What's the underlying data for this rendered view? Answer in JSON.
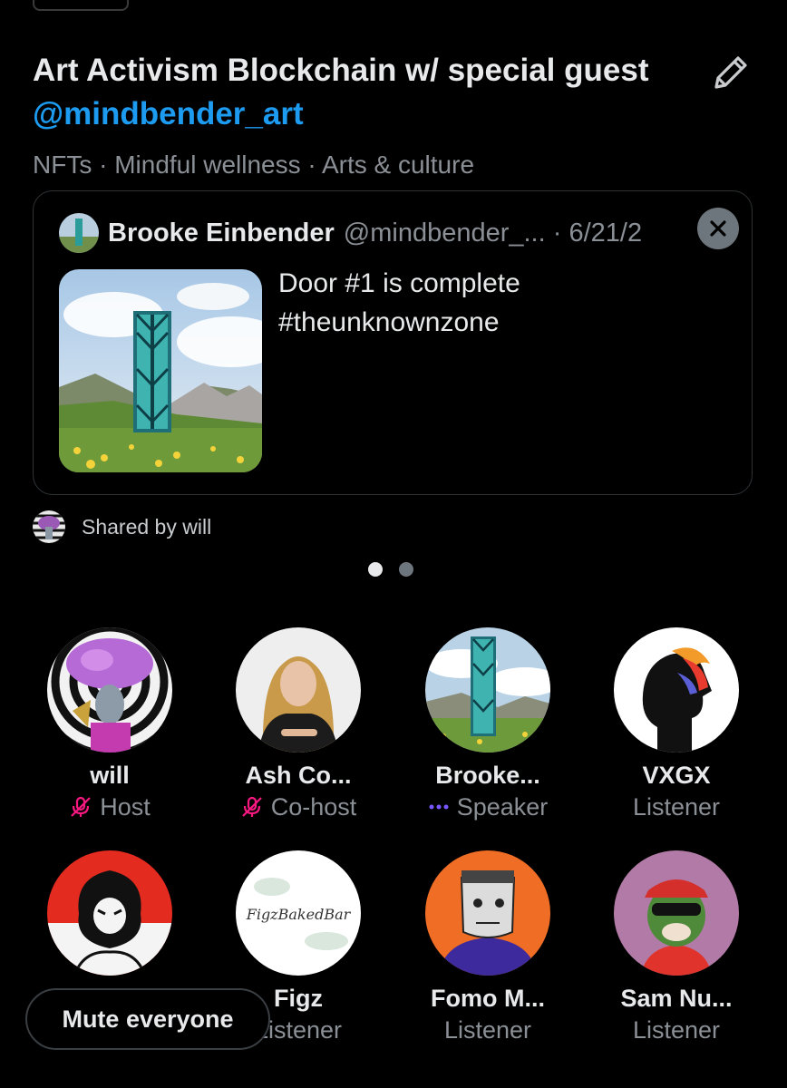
{
  "space": {
    "title_prefix": "Art Activism Blockchain w/ special guest ",
    "title_mention": "@mindbender_art",
    "topics": "NFTs · Mindful wellness · Arts & culture"
  },
  "pinned_tweet": {
    "author": "Brooke Einbender",
    "handle_date": "@mindbender_... · 6/21/2",
    "text_line1": "Door #1 is complete",
    "text_line2": "#theunknownzone"
  },
  "shared_by": "Shared by will",
  "pager": {
    "pages": 2,
    "current": 1
  },
  "participants_row1": [
    {
      "name": "will",
      "role": "Host",
      "role_icon": "muted-mic-icon"
    },
    {
      "name": "Ash Co...",
      "role": "Co-host",
      "role_icon": "muted-mic-icon"
    },
    {
      "name": "Brooke...",
      "role": "Speaker",
      "role_icon": "speaking-dots-icon"
    },
    {
      "name": "VXGX",
      "role": "Listener",
      "role_icon": ""
    }
  ],
  "participants_row2": [
    {
      "name": "",
      "role": "",
      "role_icon": ""
    },
    {
      "name": "Figz",
      "role": "Listener",
      "role_icon": ""
    },
    {
      "name": "Fomo M...",
      "role": "Listener",
      "role_icon": ""
    },
    {
      "name": "Sam Nu...",
      "role": "Listener",
      "role_icon": ""
    }
  ],
  "mute_button": "Mute everyone",
  "figz_avatar_text": "FigzBakedBar",
  "colors": {
    "background": "#000000",
    "accent": "#1d9bf0",
    "muted_text": "#8b9096",
    "mute_icon": "#f91880",
    "speaking": "#7856ff"
  }
}
